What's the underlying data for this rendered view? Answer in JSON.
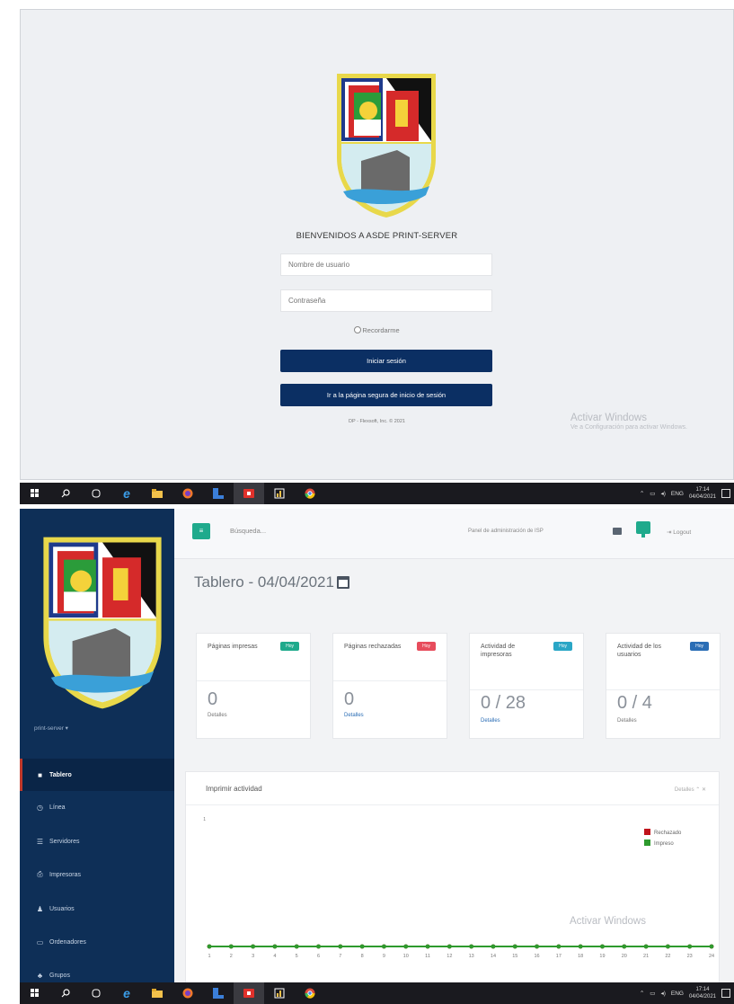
{
  "login": {
    "welcome": "BIENVENIDOS A ASDE PRINT-SERVER",
    "username_placeholder": "Nombre de usuario",
    "password_placeholder": "Contraseña",
    "remember_label": "Recordarme",
    "login_button": "Iniciar sesión",
    "secure_login_button": "Ir a la página segura de inicio de sesión",
    "copyright": "DP - Flexsoft, Inc. © 2021"
  },
  "activate_windows": {
    "title": "Activar Windows",
    "subtitle": "Ve a Configuración para activar Windows."
  },
  "taskbar": {
    "icons": [
      "windows-start-icon",
      "search-icon",
      "task-view-icon",
      "edge-icon",
      "file-explorer-icon",
      "firefox-icon",
      "app-icon",
      "red-app-icon",
      "chart-app-icon",
      "chrome-icon"
    ],
    "language": "ENG",
    "time": "17:14",
    "date": "04/04/2021"
  },
  "dashboard": {
    "search_placeholder": "Búsqueda...",
    "admin_panel_link": "Panel de administración de ISP",
    "logout_label": "Logout",
    "user_menu": "print-server ▾",
    "page_title": "Tablero - 04/04/2021",
    "nav": [
      {
        "label": "Tablero",
        "icon": "dashboard-icon",
        "active": true
      },
      {
        "label": "Línea",
        "icon": "clock-icon",
        "active": false
      },
      {
        "label": "Servidores",
        "icon": "server-icon",
        "active": false
      },
      {
        "label": "Impresoras",
        "icon": "printer-icon",
        "active": false
      },
      {
        "label": "Usuarios",
        "icon": "user-icon",
        "active": false
      },
      {
        "label": "Ordenadores",
        "icon": "computer-icon",
        "active": false
      },
      {
        "label": "Grupos",
        "icon": "group-icon",
        "active": false
      }
    ],
    "stats": [
      {
        "label": "Páginas impresas",
        "badge": "Hoy",
        "badge_color": "#1faa8c",
        "value": "0",
        "sub": "Detalles"
      },
      {
        "label": "Páginas rechazadas",
        "badge": "Hoy",
        "badge_color": "#e74c5c",
        "value": "0",
        "sub": "Detalles"
      },
      {
        "label": "Actividad de impresoras",
        "badge": "Hoy",
        "badge_color": "#2aa6c6",
        "value": "0 / 28",
        "sub": "Detalles"
      },
      {
        "label": "Actividad de los usuarios",
        "badge": "Hoy",
        "badge_color": "#2a6db5",
        "value": "0 / 4",
        "sub": "Detalles"
      }
    ],
    "chart_panel": {
      "title": "Imprimir actividad",
      "tools": "Detalles ⌃ ✕"
    }
  },
  "chart_data": {
    "type": "line",
    "title": "Imprimir actividad",
    "x": [
      1,
      2,
      3,
      4,
      5,
      6,
      7,
      8,
      9,
      10,
      11,
      12,
      13,
      14,
      15,
      16,
      17,
      18,
      19,
      20,
      21,
      22,
      23,
      24
    ],
    "series": [
      {
        "name": "Rechazado",
        "color": "#c0141c",
        "values": [
          0,
          0,
          0,
          0,
          0,
          0,
          0,
          0,
          0,
          0,
          0,
          0,
          0,
          0,
          0,
          0,
          0,
          0,
          0,
          0,
          0,
          0,
          0,
          0
        ]
      },
      {
        "name": "Impreso",
        "color": "#2e9a2e",
        "values": [
          0,
          0,
          0,
          0,
          0,
          0,
          0,
          0,
          0,
          0,
          0,
          0,
          0,
          0,
          0,
          0,
          0,
          0,
          0,
          0,
          0,
          0,
          0,
          0
        ]
      }
    ],
    "ylim": [
      0,
      1
    ],
    "y_ticks": [
      1
    ],
    "grid": false,
    "legend": "top-right"
  },
  "colors": {
    "navy": "#0b2f63",
    "sidebar": "#0e2f57",
    "teal": "#1faa8c"
  }
}
